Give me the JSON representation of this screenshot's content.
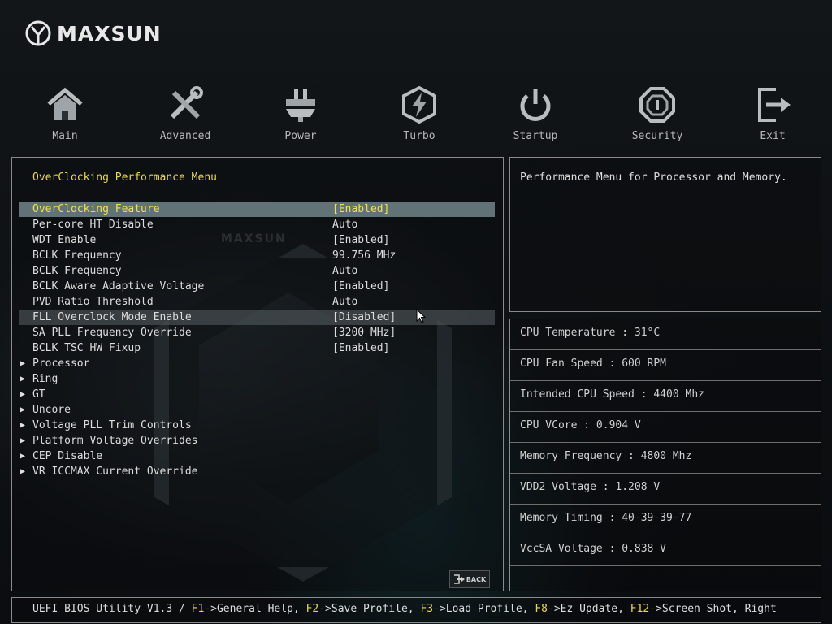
{
  "brand": {
    "name": "MAXSUN",
    "watermark": "MAXSUN"
  },
  "nav": [
    {
      "label": "Main",
      "icon": "home-icon"
    },
    {
      "label": "Advanced",
      "icon": "tools-icon"
    },
    {
      "label": "Power",
      "icon": "power-plug-icon"
    },
    {
      "label": "Turbo",
      "icon": "lightning-icon"
    },
    {
      "label": "Startup",
      "icon": "power-button-icon"
    },
    {
      "label": "Security",
      "icon": "shield-icon"
    },
    {
      "label": "Exit",
      "icon": "exit-icon"
    }
  ],
  "menu": {
    "title": "OverClocking Performance Menu",
    "items": [
      {
        "label": "OverClocking Feature",
        "value": "[Enabled]"
      },
      {
        "label": "Per-core HT Disable",
        "value": "Auto"
      },
      {
        "label": "WDT Enable",
        "value": "[Enabled]"
      },
      {
        "label": "BCLK Frequency",
        "value": "99.756 MHz"
      },
      {
        "label": "BCLK Frequency",
        "value": "Auto"
      },
      {
        "label": "BCLK Aware Adaptive Voltage",
        "value": "[Enabled]"
      },
      {
        "label": "PVD Ratio Threshold",
        "value": "Auto"
      },
      {
        "label": "FLL Overclock Mode Enable",
        "value": "[Disabled]"
      },
      {
        "label": "SA PLL Frequency Override",
        "value": "[3200 MHz]"
      },
      {
        "label": "BCLK TSC HW Fixup",
        "value": "[Enabled]"
      }
    ],
    "submenus": [
      "Processor",
      "Ring",
      "GT",
      "Uncore",
      "Voltage PLL Trim Controls",
      "Platform Voltage Overrides",
      "CEP Disable",
      "VR ICCMAX Current Override"
    ],
    "back_label": "BACK"
  },
  "help": {
    "text": "Performance Menu for Processor and Memory."
  },
  "status": [
    "CPU Temperature : 31°C",
    "CPU Fan Speed : 600 RPM",
    "Intended CPU Speed : 4400 Mhz",
    "CPU VCore : 0.904 V",
    "Memory Frequency : 4800 Mhz",
    "VDD2 Voltage : 1.208 V",
    "Memory Timing : 40-39-39-77",
    "VccSA Voltage : 0.838 V"
  ],
  "footer": {
    "prefix": "UEFI BIOS Utility V1.3 / ",
    "keys": [
      {
        "key": "F1",
        "action": "->General Help, "
      },
      {
        "key": "F2",
        "action": "->Save Profile, "
      },
      {
        "key": "F3",
        "action": "->Load Profile, "
      },
      {
        "key": "F8",
        "action": "->Ez Update, "
      },
      {
        "key": "F12",
        "action": "->Screen Shot, Right"
      }
    ]
  },
  "colors": {
    "accent": "#e8d84a",
    "selected_row": "#7a8c90"
  }
}
